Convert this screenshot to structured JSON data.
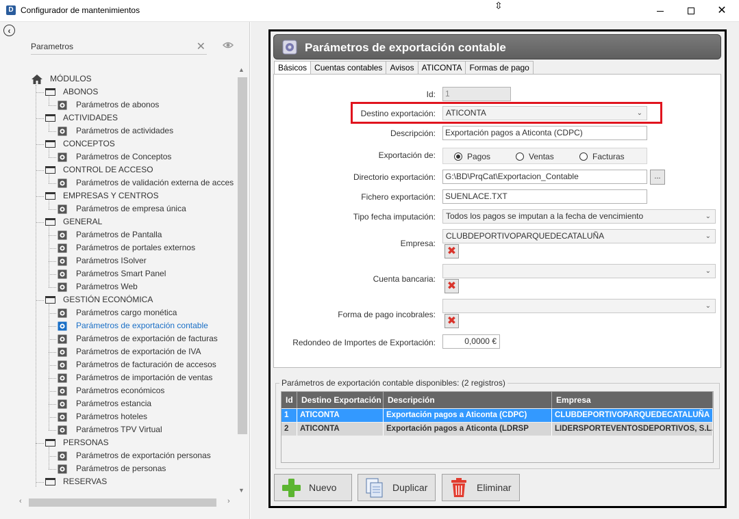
{
  "window": {
    "title": "Configurador de mantenimientos",
    "app_icon_letter": "D",
    "cursor_glyph": "⇳"
  },
  "sidebar": {
    "search_value": "Parametros",
    "search_clear": "✕",
    "back_glyph": "‹",
    "tree": [
      {
        "kind": "root",
        "label": "MÓDULOS",
        "icon": "home-icon"
      },
      {
        "kind": "folder",
        "label": "ABONOS"
      },
      {
        "kind": "item",
        "label": "Parámetros de abonos"
      },
      {
        "kind": "folder",
        "label": "ACTIVIDADES"
      },
      {
        "kind": "item",
        "label": "Parámetros de actividades"
      },
      {
        "kind": "folder",
        "label": "CONCEPTOS"
      },
      {
        "kind": "item",
        "label": "Parámetros de Conceptos"
      },
      {
        "kind": "folder",
        "label": "CONTROL DE ACCESO"
      },
      {
        "kind": "item",
        "label": "Parámetros de validación externa de acces"
      },
      {
        "kind": "folder",
        "label": "EMPRESAS Y CENTROS"
      },
      {
        "kind": "item",
        "label": "Parámetros de empresa única"
      },
      {
        "kind": "folder",
        "label": "GENERAL"
      },
      {
        "kind": "item",
        "label": "Parámetros de Pantalla"
      },
      {
        "kind": "item",
        "label": "Parámetros de portales externos"
      },
      {
        "kind": "item",
        "label": "Parámetros ISolver"
      },
      {
        "kind": "item",
        "label": "Parámetros Smart Panel"
      },
      {
        "kind": "item",
        "label": "Parámetros Web"
      },
      {
        "kind": "folder",
        "label": "GESTIÓN ECONÓMICA"
      },
      {
        "kind": "item",
        "label": "Parámetros cargo monética"
      },
      {
        "kind": "item",
        "label": "Parámetros de exportación contable",
        "selected": true
      },
      {
        "kind": "item",
        "label": "Parámetros de exportación de facturas"
      },
      {
        "kind": "item",
        "label": "Parámetros de exportación de IVA"
      },
      {
        "kind": "item",
        "label": "Parámetros de facturación de accesos"
      },
      {
        "kind": "item",
        "label": "Parámetros de importación de ventas"
      },
      {
        "kind": "item",
        "label": "Parámetros económicos"
      },
      {
        "kind": "item",
        "label": "Parámetros estancia"
      },
      {
        "kind": "item",
        "label": "Parámetros hoteles"
      },
      {
        "kind": "item",
        "label": "Parámetros TPV Virtual"
      },
      {
        "kind": "folder",
        "label": "PERSONAS"
      },
      {
        "kind": "item",
        "label": "Parámetros de exportación personas"
      },
      {
        "kind": "item",
        "label": "Parámetros de personas"
      },
      {
        "kind": "folder",
        "label": "RESERVAS"
      }
    ],
    "accent_color": "#1a6fc6"
  },
  "panel": {
    "title": "Parámetros de exportación contable",
    "tabs": [
      "Básicos",
      "Cuentas contables",
      "Avisos",
      "ATICONTA",
      "Formas de pago"
    ],
    "active_tab": "Básicos",
    "form": {
      "id_label": "Id:",
      "id_value": "1",
      "destino_label": "Destino exportación:",
      "destino_value": "ATICONTA",
      "descripcion_label": "Descripción:",
      "descripcion_value": "Exportación pagos a Aticonta (CDPC)",
      "exportacion_label": "Exportación de:",
      "radio_options": [
        "Pagos",
        "Ventas",
        "Facturas"
      ],
      "radio_selected": "Pagos",
      "directorio_label": "Directorio exportación:",
      "directorio_value": "G:\\BD\\PrqCat\\Exportacion_Contable",
      "browse_label": "...",
      "fichero_label": "Fichero exportación:",
      "fichero_value": "SUENLACE.TXT",
      "tipo_fecha_label": "Tipo fecha imputación:",
      "tipo_fecha_value": "Todos los pagos se imputan a la fecha de vencimiento",
      "empresa_label": "Empresa:",
      "empresa_value": "CLUBDEPORTIVOPARQUEDECATALUÑA",
      "cuenta_label": "Cuenta bancaria:",
      "cuenta_value": "",
      "forma_pago_label": "Forma de pago incobrales:",
      "forma_pago_value": "",
      "redondeo_label": "Redondeo de Importes de Exportación:",
      "redondeo_value": "0,0000 €",
      "highlight_color": "#e0141e"
    },
    "grid": {
      "legend": "Parámetros de exportación contable disponibles:  (2 registros)",
      "columns": [
        "Id",
        "Destino Exportación",
        "Descripción",
        "Empresa"
      ],
      "rows": [
        {
          "id": "1",
          "destino": "ATICONTA",
          "descripcion": "Exportación pagos a Aticonta (CDPC)",
          "empresa": "CLUBDEPORTIVOPARQUEDECATALUÑA",
          "selected": true
        },
        {
          "id": "2",
          "destino": "ATICONTA",
          "descripcion": "Exportación pagos a Aticonta (LDRSP",
          "empresa": "LIDERSPORTEVENTOSDEPORTIVOS, S.L.",
          "selected": false
        }
      ],
      "selected_color": "#3399ff"
    },
    "buttons": {
      "nuevo": "Nuevo",
      "duplicar": "Duplicar",
      "eliminar": "Eliminar"
    }
  }
}
